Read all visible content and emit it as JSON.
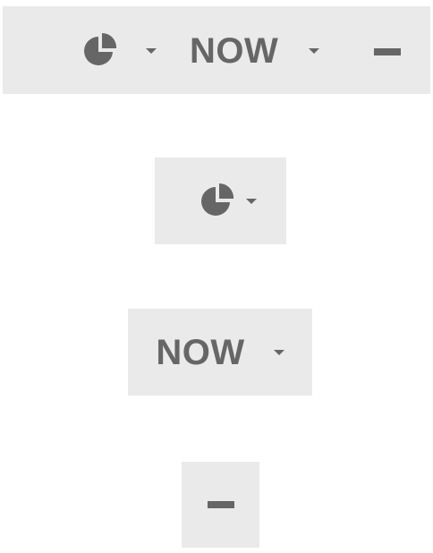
{
  "toolbar": {
    "chart_icon": "pie-chart-icon",
    "chart_dropdown_icon": "caret-down-icon",
    "time_label": "NOW",
    "time_dropdown_icon": "caret-down-icon",
    "collapse_icon": "minus-icon"
  },
  "standalone": {
    "chart_icon": "pie-chart-icon",
    "chart_dropdown_icon": "caret-down-icon",
    "time_label": "NOW",
    "time_dropdown_icon": "caret-down-icon",
    "collapse_icon": "minus-icon"
  },
  "colors": {
    "button_background": "#eaeaea",
    "icon_color": "#666666",
    "page_background": "#ffffff"
  }
}
